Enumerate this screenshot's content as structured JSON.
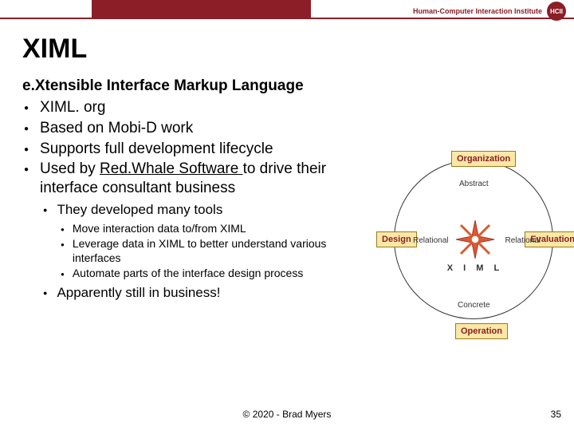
{
  "header": {
    "institute": "Human-Computer Interaction Institute",
    "logo_abbrev": "HCII"
  },
  "title": "XIML",
  "subtitle": "e.Xtensible Interface Markup Language",
  "bullets_lvl1": [
    {
      "text": "XIML. org"
    },
    {
      "text": "Based on Mobi-D work"
    },
    {
      "text": "Supports full development lifecycle"
    },
    {
      "prefix": "Used by ",
      "link": "Red.Whale Software ",
      "suffix": "to drive their interface consultant business"
    }
  ],
  "bullets_lvl2a": [
    "They developed many tools"
  ],
  "bullets_lvl3": [
    "Move interaction data to/from XIML",
    "Leverage data in XIML to better understand various interfaces",
    "Automate parts of the interface design process"
  ],
  "bullets_lvl2b": [
    "Apparently still in business!"
  ],
  "diagram": {
    "boxes": {
      "org": "Organization",
      "design": "Design",
      "eval": "Evaluation",
      "op": "Operation"
    },
    "labels": {
      "abstract": "Abstract",
      "relL": "Relational",
      "relR": "Relational",
      "concrete": "Concrete"
    },
    "center": "X I M L"
  },
  "footer": "© 2020 - Brad Myers",
  "page_number": "35"
}
